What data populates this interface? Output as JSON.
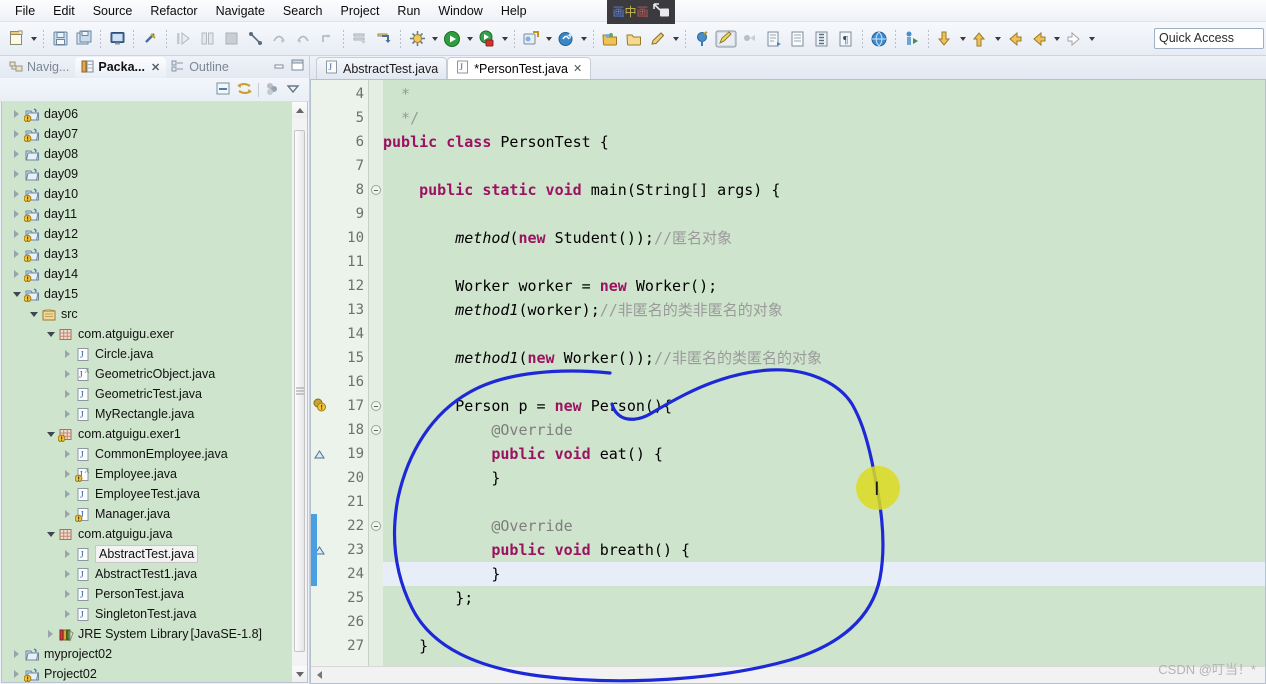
{
  "menubar": {
    "items": [
      "File",
      "Edit",
      "Source",
      "Refactor",
      "Navigate",
      "Search",
      "Project",
      "Run",
      "Window",
      "Help"
    ]
  },
  "toolbar": {
    "quick_access_placeholder": "Quick Access",
    "icons": [
      "new-file-icon",
      "new-dropdown-caret",
      "save-icon",
      "save-all-icon",
      "console-icon",
      "link-break-icon",
      "run-step-icon",
      "pause-icon",
      "stop-icon",
      "step-into-icon",
      "step-over-icon",
      "step-return-icon",
      "drop-to-frame-icon",
      "skip-breakpoints-icon",
      "debug-arrow-icon",
      "build-icon",
      "build-caret",
      "run-icon",
      "run-caret",
      "debug-icon",
      "debug-caret",
      "external-tools-icon",
      "external-tools-caret",
      "search-bean-icon",
      "search-bean-caret",
      "open-type-icon",
      "open-folder-icon",
      "pencil-icon",
      "pencil-caret",
      "marker-icon",
      "highlight-icon",
      "annotate-icon",
      "task-icon",
      "ruler-icon",
      "outline-icon",
      "paragraph-icon",
      "globe-icon",
      "person-run-icon",
      "down-arrow-icon",
      "down-caret",
      "up-arrow-icon",
      "up-caret",
      "back-star-icon",
      "back-arrow-icon",
      "back-caret",
      "forward-arrow-icon",
      "forward-caret"
    ]
  },
  "pip_overlay": {
    "label_chars": [
      "画",
      "中",
      "画"
    ],
    "icon": "picture-in-picture-icon"
  },
  "left_view": {
    "tabs": [
      {
        "label": "Navig...",
        "icon": "navigator-icon",
        "active": false,
        "closable": false
      },
      {
        "label": "Packa...",
        "icon": "package-explorer-icon",
        "active": true,
        "closable": true
      },
      {
        "label": "Outline",
        "icon": "outline-view-icon",
        "active": false,
        "closable": false
      }
    ],
    "tab_controls": [
      "minimize-icon",
      "maximize-icon"
    ],
    "view_toolbar": [
      "collapse-all-icon",
      "link-with-editor-icon",
      "filter-icon",
      "view-menu-icon"
    ],
    "tree": [
      {
        "label": "day06",
        "indent": 0,
        "state": "closed",
        "icon": "java-project-warn"
      },
      {
        "label": "day07",
        "indent": 0,
        "state": "closed",
        "icon": "java-project-warn"
      },
      {
        "label": "day08",
        "indent": 0,
        "state": "closed",
        "icon": "java-project"
      },
      {
        "label": "day09",
        "indent": 0,
        "state": "closed",
        "icon": "java-project"
      },
      {
        "label": "day10",
        "indent": 0,
        "state": "closed",
        "icon": "java-project-warn"
      },
      {
        "label": "day11",
        "indent": 0,
        "state": "closed",
        "icon": "java-project-warn"
      },
      {
        "label": "day12",
        "indent": 0,
        "state": "closed",
        "icon": "java-project-warn"
      },
      {
        "label": "day13",
        "indent": 0,
        "state": "closed",
        "icon": "java-project-warn"
      },
      {
        "label": "day14",
        "indent": 0,
        "state": "closed",
        "icon": "java-project-warn"
      },
      {
        "label": "day15",
        "indent": 0,
        "state": "open",
        "icon": "java-project-warn"
      },
      {
        "label": "src",
        "indent": 1,
        "state": "open",
        "icon": "source-folder"
      },
      {
        "label": "com.atguigu.exer",
        "indent": 2,
        "state": "open",
        "icon": "package"
      },
      {
        "label": "Circle.java",
        "indent": 3,
        "state": "closed",
        "icon": "java-file"
      },
      {
        "label": "GeometricObject.java",
        "indent": 3,
        "state": "closed",
        "icon": "java-abstract-file"
      },
      {
        "label": "GeometricTest.java",
        "indent": 3,
        "state": "closed",
        "icon": "java-file"
      },
      {
        "label": "MyRectangle.java",
        "indent": 3,
        "state": "closed",
        "icon": "java-file"
      },
      {
        "label": "com.atguigu.exer1",
        "indent": 2,
        "state": "open",
        "icon": "package-warn"
      },
      {
        "label": "CommonEmployee.java",
        "indent": 3,
        "state": "closed",
        "icon": "java-file"
      },
      {
        "label": "Employee.java",
        "indent": 3,
        "state": "closed",
        "icon": "java-abstract-warn-file"
      },
      {
        "label": "EmployeeTest.java",
        "indent": 3,
        "state": "closed",
        "icon": "java-file"
      },
      {
        "label": "Manager.java",
        "indent": 3,
        "state": "closed",
        "icon": "java-warn-file"
      },
      {
        "label": "com.atguigu.java",
        "indent": 2,
        "state": "open",
        "icon": "package"
      },
      {
        "label": "AbstractTest.java",
        "indent": 3,
        "state": "closed",
        "icon": "java-file",
        "selected": true
      },
      {
        "label": "AbstractTest1.java",
        "indent": 3,
        "state": "closed",
        "icon": "java-file"
      },
      {
        "label": "PersonTest.java",
        "indent": 3,
        "state": "closed",
        "icon": "java-file"
      },
      {
        "label": "SingletonTest.java",
        "indent": 3,
        "state": "closed",
        "icon": "java-file"
      },
      {
        "label": "JRE System Library",
        "dim": " [JavaSE-1.8]",
        "indent": 2,
        "state": "closed",
        "icon": "jre-library"
      },
      {
        "label": "myproject02",
        "indent": 0,
        "state": "closed",
        "icon": "java-project"
      },
      {
        "label": "Project02",
        "indent": 0,
        "state": "closed",
        "icon": "java-project-warn"
      }
    ]
  },
  "editor": {
    "tabs": [
      {
        "label": "AbstractTest.java",
        "icon": "java-file-icon",
        "active": false,
        "dirty": false,
        "closable": false
      },
      {
        "label": "*PersonTest.java",
        "icon": "java-file-icon",
        "active": true,
        "dirty": true,
        "closable": true
      }
    ],
    "first_visible_line": 4,
    "current_line": 24,
    "change_bar_lines": [
      22,
      23,
      24
    ],
    "lines": [
      {
        "n": 4,
        "segments": [
          {
            "t": "  * ",
            "c": "cm"
          }
        ]
      },
      {
        "n": 5,
        "segments": [
          {
            "t": "  */",
            "c": "cm"
          }
        ]
      },
      {
        "n": 6,
        "segments": [
          {
            "t": "public class ",
            "c": "kw"
          },
          {
            "t": "PersonTest {",
            "c": ""
          }
        ]
      },
      {
        "n": 7,
        "segments": [
          {
            "t": "",
            "c": ""
          }
        ]
      },
      {
        "n": 8,
        "fold": true,
        "segments": [
          {
            "t": "    ",
            "c": ""
          },
          {
            "t": "public static void ",
            "c": "kw"
          },
          {
            "t": "main(String[] args) {",
            "c": ""
          }
        ]
      },
      {
        "n": 9,
        "segments": [
          {
            "t": "",
            "c": ""
          }
        ]
      },
      {
        "n": 10,
        "segments": [
          {
            "t": "        ",
            "c": ""
          },
          {
            "t": "method",
            "c": "it"
          },
          {
            "t": "(",
            "c": ""
          },
          {
            "t": "new ",
            "c": "kw"
          },
          {
            "t": "Student());",
            "c": ""
          },
          {
            "t": "//匿名对象",
            "c": "cm"
          }
        ]
      },
      {
        "n": 11,
        "segments": [
          {
            "t": "",
            "c": ""
          }
        ]
      },
      {
        "n": 12,
        "segments": [
          {
            "t": "        Worker worker = ",
            "c": ""
          },
          {
            "t": "new ",
            "c": "kw"
          },
          {
            "t": "Worker();",
            "c": ""
          }
        ]
      },
      {
        "n": 13,
        "segments": [
          {
            "t": "        ",
            "c": ""
          },
          {
            "t": "method1",
            "c": "it"
          },
          {
            "t": "(worker);",
            "c": ""
          },
          {
            "t": "//非匿名的类非匿名的对象",
            "c": "cm"
          }
        ]
      },
      {
        "n": 14,
        "segments": [
          {
            "t": "",
            "c": ""
          }
        ]
      },
      {
        "n": 15,
        "segments": [
          {
            "t": "        ",
            "c": ""
          },
          {
            "t": "method1",
            "c": "it"
          },
          {
            "t": "(",
            "c": ""
          },
          {
            "t": "new ",
            "c": "kw"
          },
          {
            "t": "Worker());",
            "c": ""
          },
          {
            "t": "//非匿名的类匿名的对象",
            "c": "cm"
          }
        ]
      },
      {
        "n": 16,
        "segments": [
          {
            "t": "",
            "c": ""
          }
        ]
      },
      {
        "n": 17,
        "warn": true,
        "fold": true,
        "segments": [
          {
            "t": "        Person p = ",
            "c": ""
          },
          {
            "t": "new ",
            "c": "kw"
          },
          {
            "t": "Person(){",
            "c": ""
          }
        ]
      },
      {
        "n": 18,
        "fold": true,
        "segments": [
          {
            "t": "            ",
            "c": ""
          },
          {
            "t": "@Override",
            "c": "ann"
          }
        ]
      },
      {
        "n": 19,
        "tri": true,
        "segments": [
          {
            "t": "            ",
            "c": ""
          },
          {
            "t": "public void ",
            "c": "kw"
          },
          {
            "t": "eat() {",
            "c": ""
          }
        ]
      },
      {
        "n": 20,
        "segments": [
          {
            "t": "            }",
            "c": ""
          }
        ]
      },
      {
        "n": 21,
        "segments": [
          {
            "t": "",
            "c": ""
          }
        ]
      },
      {
        "n": 22,
        "fold": true,
        "segments": [
          {
            "t": "            ",
            "c": ""
          },
          {
            "t": "@Override",
            "c": "ann"
          }
        ]
      },
      {
        "n": 23,
        "tri": true,
        "segments": [
          {
            "t": "            ",
            "c": ""
          },
          {
            "t": "public void ",
            "c": "kw"
          },
          {
            "t": "breath() {",
            "c": ""
          }
        ]
      },
      {
        "n": 24,
        "segments": [
          {
            "t": "            }",
            "c": ""
          }
        ]
      },
      {
        "n": 25,
        "segments": [
          {
            "t": "        };",
            "c": ""
          }
        ]
      },
      {
        "n": 26,
        "segments": [
          {
            "t": "",
            "c": ""
          }
        ]
      },
      {
        "n": 27,
        "segments": [
          {
            "t": "    }",
            "c": ""
          }
        ]
      }
    ]
  },
  "annotation": {
    "type": "hand-drawn-blue-circle",
    "color": "#1d29d6",
    "cursor_highlight_color": "#dcdc1e"
  },
  "watermark": {
    "text": "CSDN @叮当！*"
  },
  "colors": {
    "editor_background": "#cfe4cd",
    "keyword": "#9b1261",
    "comment": "#9a9a9a",
    "annotation_gray": "#7d7d7d",
    "current_line": "#e8eef7",
    "change_bar": "#4a9fe0"
  }
}
